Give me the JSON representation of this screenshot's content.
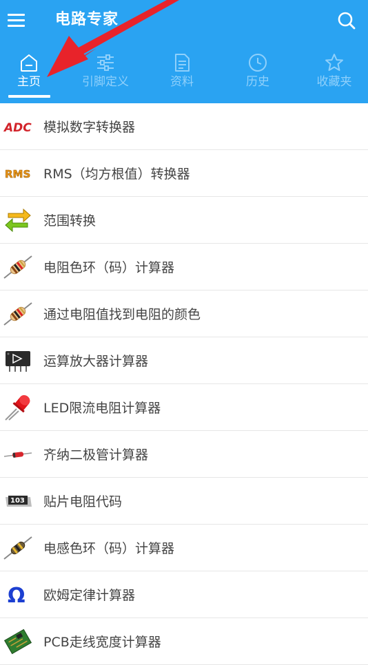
{
  "app": {
    "title": "电路专家",
    "accent_color": "#2aa3f2"
  },
  "header": {
    "menu_icon": "hamburger-menu-icon",
    "search_icon": "search-icon"
  },
  "tabs": [
    {
      "label": "主页",
      "icon": "home-icon",
      "active": true
    },
    {
      "label": "引脚定义",
      "icon": "sliders-icon",
      "active": false
    },
    {
      "label": "资料",
      "icon": "document-icon",
      "active": false
    },
    {
      "label": "历史",
      "icon": "clock-icon",
      "active": false
    },
    {
      "label": "收藏夹",
      "icon": "star-icon",
      "active": false
    }
  ],
  "list": [
    {
      "label": "模拟数字转换器",
      "icon": "adc-icon",
      "icon_text": "ADC"
    },
    {
      "label": "RMS（均方根值）转换器",
      "icon": "rms-icon",
      "icon_text": "RMS"
    },
    {
      "label": "范围转换",
      "icon": "range-convert-arrows-icon"
    },
    {
      "label": "电阻色环（码）计算器",
      "icon": "resistor-icon"
    },
    {
      "label": "通过电阻值找到电阻的颜色",
      "icon": "resistor-icon"
    },
    {
      "label": "运算放大器计算器",
      "icon": "op-amp-chip-icon"
    },
    {
      "label": "LED限流电阻计算器",
      "icon": "led-icon"
    },
    {
      "label": "齐纳二极管计算器",
      "icon": "zener-diode-icon"
    },
    {
      "label": "贴片电阻代码",
      "icon": "smd-resistor-icon",
      "icon_text": "103"
    },
    {
      "label": "电感色环（码）计算器",
      "icon": "inductor-icon"
    },
    {
      "label": "欧姆定律计算器",
      "icon": "omega-icon",
      "icon_text": "Ω"
    },
    {
      "label": "PCB走线宽度计算器",
      "icon": "pcb-icon"
    }
  ]
}
